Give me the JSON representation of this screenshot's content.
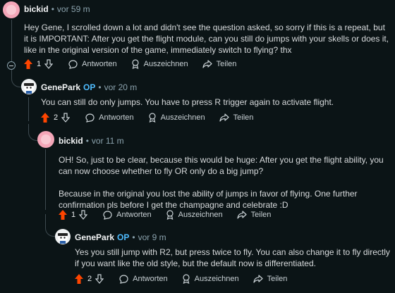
{
  "comments": [
    {
      "author": "bickid",
      "op_badge": "",
      "time": "vor 59 m",
      "paragraphs": [
        "Hey Gene, I scrolled down a lot and didn't see the question asked, so sorry if this is a repeat, but it is IMPORTANT: After you get the flight module, can you still do jumps with your skells or does it, like in the original version of the game, immediately switch to flying? thx"
      ],
      "score": "1"
    },
    {
      "author": "GenePark",
      "op_badge": "OP",
      "time": "vor 20 m",
      "paragraphs": [
        "You can still do only jumps. You have to press R trigger again to activate flight."
      ],
      "score": "2"
    },
    {
      "author": "bickid",
      "op_badge": "",
      "time": "vor 11 m",
      "paragraphs": [
        "OH! So, just to be clear, because this would be huge: After you get the flight ability, you can now choose whether to fly OR only do a big jump?",
        "Because in the original you lost the ability of jumps in favor of flying. One further confirmation pls before I get the champagne and celebrate :D"
      ],
      "score": "1"
    },
    {
      "author": "GenePark",
      "op_badge": "OP",
      "time": "vor 9 m",
      "paragraphs": [
        "Yes you still jump with R2, but press twice to fly. You can also change it to fly directly if you want like the old style, but the default now is differentiated."
      ],
      "score": "2"
    }
  ],
  "actions": {
    "reply": "Antworten",
    "award": "Auszeichnen",
    "share": "Teilen"
  },
  "separator": "•",
  "colors": {
    "background": "#0b1416",
    "upvote_active": "#ff4500",
    "op_badge": "#4fbcff",
    "thread_line": "#3e4a50"
  }
}
